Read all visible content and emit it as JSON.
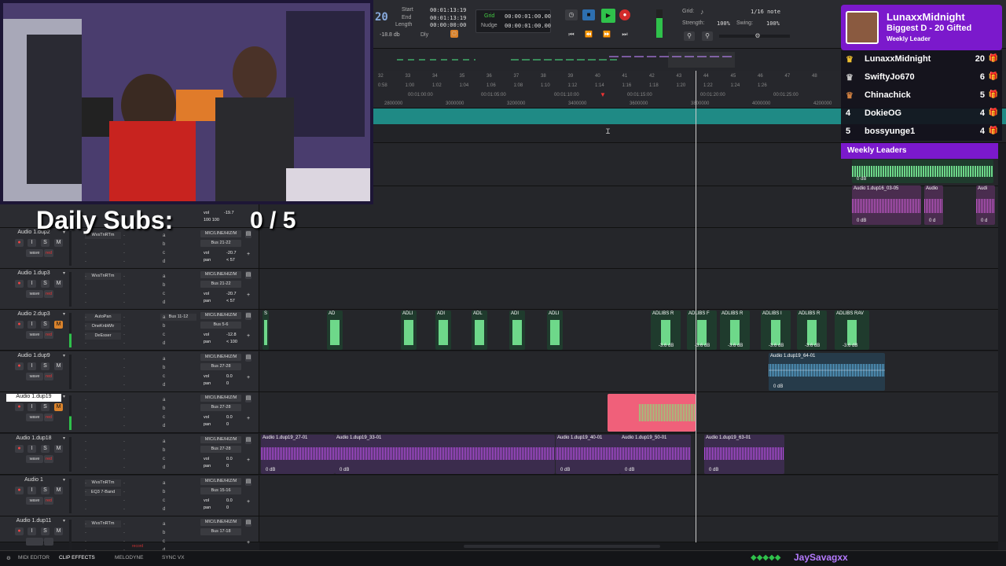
{
  "transport": {
    "counter_partial": "20",
    "start_label": "Start",
    "start_value": "00:01:13:19",
    "end_label": "End",
    "end_value": "00:01:13:19",
    "length_label": "Length",
    "length_value": "00:00:00:00",
    "db_readout": "-18.8 db",
    "dly_label": "Dly",
    "grid_label": "Grid",
    "grid_value": "00:00:01:00.00",
    "nudge_label": "Nudge",
    "nudge_value": "00:00:01:00.00",
    "grid2_label": "Grid:",
    "grid2_value": "1/16 note",
    "strength_label": "Strength:",
    "strength_value": "100%",
    "swing_label": "Swing:",
    "swing_value": "100%"
  },
  "ruler": {
    "bars": [
      "32",
      "33",
      "34",
      "35",
      "36",
      "37",
      "38",
      "39",
      "40",
      "41",
      "42",
      "43",
      "44",
      "45",
      "46",
      "47",
      "48"
    ],
    "minsecs": [
      "0:58",
      "1:00",
      "1:02",
      "1:04",
      "1:06",
      "1:08",
      "1:10",
      "1:12",
      "1:14",
      "1:16",
      "1:18",
      "1:20",
      "1:22",
      "1:24",
      "1:26"
    ],
    "timecodes": [
      "00:01:00:00",
      "00:01:05:00",
      "00:01:10:00",
      "00:01:15:00",
      "00:01:20:00",
      "00:01:25:00"
    ],
    "samples": [
      "2800000",
      "3000000",
      "3200000",
      "3400000",
      "3600000",
      "3800000",
      "4000000",
      "4200000"
    ]
  },
  "overlay": {
    "daily_subs_label": "Daily Subs:",
    "daily_subs_value": "0 / 5"
  },
  "leaderboard": {
    "top_name": "LunaxxMidnight",
    "top_sub": "Biggest D - 20 Gifted",
    "top_tag": "Weekly Leader",
    "rows": [
      {
        "rank": "",
        "name": "LunaxxMidnight",
        "count": "20"
      },
      {
        "rank": "",
        "name": "SwiftyJo670",
        "count": "6"
      },
      {
        "rank": "",
        "name": "Chinachick",
        "count": "5"
      },
      {
        "rank": "4",
        "name": "DokieOG",
        "count": "4"
      },
      {
        "rank": "5",
        "name": "bossyunge1",
        "count": "4"
      }
    ],
    "weekly_leaders": "Weekly Leaders"
  },
  "tracks": [
    {
      "name": "Audio 1.dup2",
      "insert": "WvsTnRTm",
      "io1": "MIC/LINE/HIZ/M",
      "io2": "Bus 21-22",
      "vol": "-20.7",
      "pan": "< 57",
      "wave": "wave",
      "state": "red"
    },
    {
      "name": "Audio 1.dup3",
      "insert": "WvsTnRTm",
      "io1": "MIC/LINE/HIZ/M",
      "io2": "Bus 21-22",
      "vol": "-20.7",
      "pan": "< 57",
      "wave": "wave",
      "state": "red"
    },
    {
      "name": "Audio 2.dup3",
      "insert": "AutoPan",
      "insert2": "OneKnbWtr",
      "insert3": "DeEsser",
      "send": "Bus 11-12",
      "io1": "MIC/LINE/HIZ/M",
      "io2": "Bus 5-6",
      "vol": "-12.8",
      "pan": "< 100",
      "wave": "wave",
      "state": "red"
    },
    {
      "name": "Audio 1.dup9",
      "insert": "",
      "io1": "MIC/LINE/HIZ/M",
      "io2": "Bus 27-28",
      "vol": "0.0",
      "pan": "0",
      "wave": "wave",
      "state": "red"
    },
    {
      "name": "Audio 1.dup19",
      "insert": "",
      "io1": "MIC/LINE/HIZ/M",
      "io2": "Bus 27-28",
      "vol": "0.0",
      "pan": "0",
      "wave": "wave",
      "state": "red"
    },
    {
      "name": "Audio 1.dup18",
      "insert": "",
      "io1": "MIC/LINE/HIZ/M",
      "io2": "Bus 27-28",
      "vol": "0.0",
      "pan": "0",
      "wave": "wave",
      "state": "red"
    },
    {
      "name": "Audio 1",
      "insert": "WvsTnRTm",
      "insert2": "EQ3 7-Band",
      "io1": "MIC/LINE/HIZ/M",
      "io2": "Bus 15-16",
      "vol": "0.0",
      "pan": "0",
      "wave": "wave",
      "state": "red"
    },
    {
      "name": "Audio 1.dup11",
      "insert": "WvsTnRTm",
      "io1": "MIC/LINE/HIZ/M",
      "io2": "Bus 17-18",
      "vol": "",
      "pan": "",
      "wave": "",
      "state": ""
    }
  ],
  "top_partial_track": {
    "vol": "-19.7",
    "pan": "100  100"
  },
  "clips": {
    "adlibs_left": [
      "S",
      "AD",
      "ADLI",
      "ADI",
      "ADL",
      "ADI",
      "ADLI"
    ],
    "adlibs_right": [
      "ADLIBS R",
      "ADLIBS F",
      "ADLIBS R",
      "ADLIBS I",
      "ADLIBS R",
      "ADLIBS RAV"
    ],
    "adlib_db": "-3.6 dB",
    "blue_clip": "Audio 1.dup19_64-01",
    "purple_clips": [
      "Audio 1.dup19_27-01",
      "Audio 1.dup19_33-01",
      "Audio 1.dup19_40-01",
      "Audio 1.dup19_50-01",
      "Audio 1.dup19_63-01"
    ],
    "zero_db": "0 dB",
    "top_right_clip": "Audio 1.dup16_03-05",
    "top_right_clip2": "Audio",
    "top_right_clip3": "Audi",
    "zero_d": "0 d"
  },
  "bottom_bar": {
    "tabs": [
      "MIDI EDITOR",
      "CLIP EFFECTS",
      "MELODYNE",
      "SYNC VX"
    ],
    "streamer": "JaySavagxx",
    "record_label": "record"
  },
  "colors": {
    "accent_purple": "#7b19cc",
    "tempo_teal": "#1f8a85",
    "play_green": "#2fc14b",
    "record_red": "#d32b2b",
    "clip_pink": "#f0607a"
  }
}
